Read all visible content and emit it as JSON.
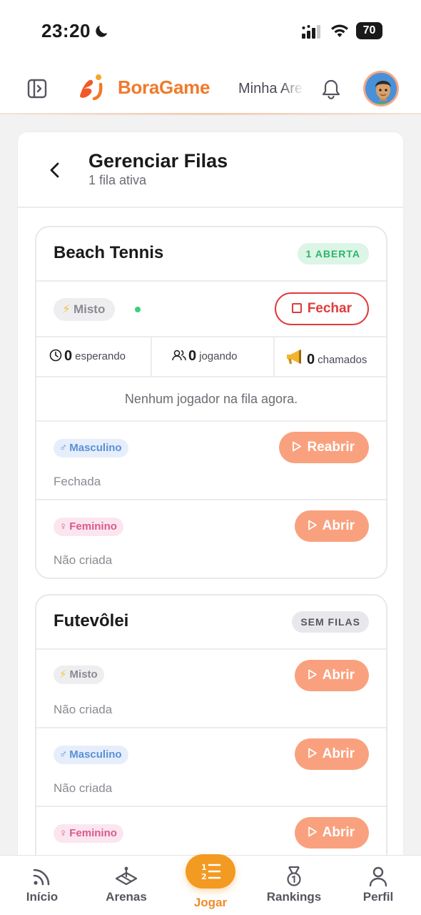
{
  "status_bar": {
    "time": "23:20",
    "battery": "70"
  },
  "header": {
    "logo_text": "BoraGame",
    "arena_link": "Minha Arena",
    "colors": {
      "brand": "#f07a2a",
      "accent": "#f9a17e"
    }
  },
  "page": {
    "title": "Gerenciar Filas",
    "subtitle": "1 fila ativa"
  },
  "sports": [
    {
      "name": "Beach Tennis",
      "badge": "1 ABERTA",
      "active_queue": {
        "category": "Misto",
        "close_label": "Fechar",
        "stats": [
          {
            "value": "0",
            "label": "esperando",
            "icon": "clock-icon"
          },
          {
            "value": "0",
            "label": "jogando",
            "icon": "users-icon"
          },
          {
            "value": "0",
            "label": "chamados",
            "icon": "megaphone-icon"
          }
        ],
        "empty_message": "Nenhum jogador na fila agora."
      },
      "queues": [
        {
          "category": "Masculino",
          "symbol": "♂",
          "state": "Fechada",
          "action": "Reabrir"
        },
        {
          "category": "Feminino",
          "symbol": "♀",
          "state": "Não criada",
          "action": "Abrir"
        }
      ]
    },
    {
      "name": "Futevôlei",
      "badge": "SEM FILAS",
      "queues": [
        {
          "category": "Misto",
          "symbol": "⚡",
          "state": "Não criada",
          "action": "Abrir"
        },
        {
          "category": "Masculino",
          "symbol": "♂",
          "state": "Não criada",
          "action": "Abrir"
        },
        {
          "category": "Feminino",
          "symbol": "♀",
          "state": "",
          "action": "Abrir"
        }
      ]
    }
  ],
  "bottom_nav": [
    {
      "label": "Início",
      "icon": "home-icon"
    },
    {
      "label": "Arenas",
      "icon": "arena-icon"
    },
    {
      "label": "Jogar",
      "icon": "queue-list-icon"
    },
    {
      "label": "Rankings",
      "icon": "medal-icon"
    },
    {
      "label": "Perfil",
      "icon": "profile-icon"
    }
  ]
}
